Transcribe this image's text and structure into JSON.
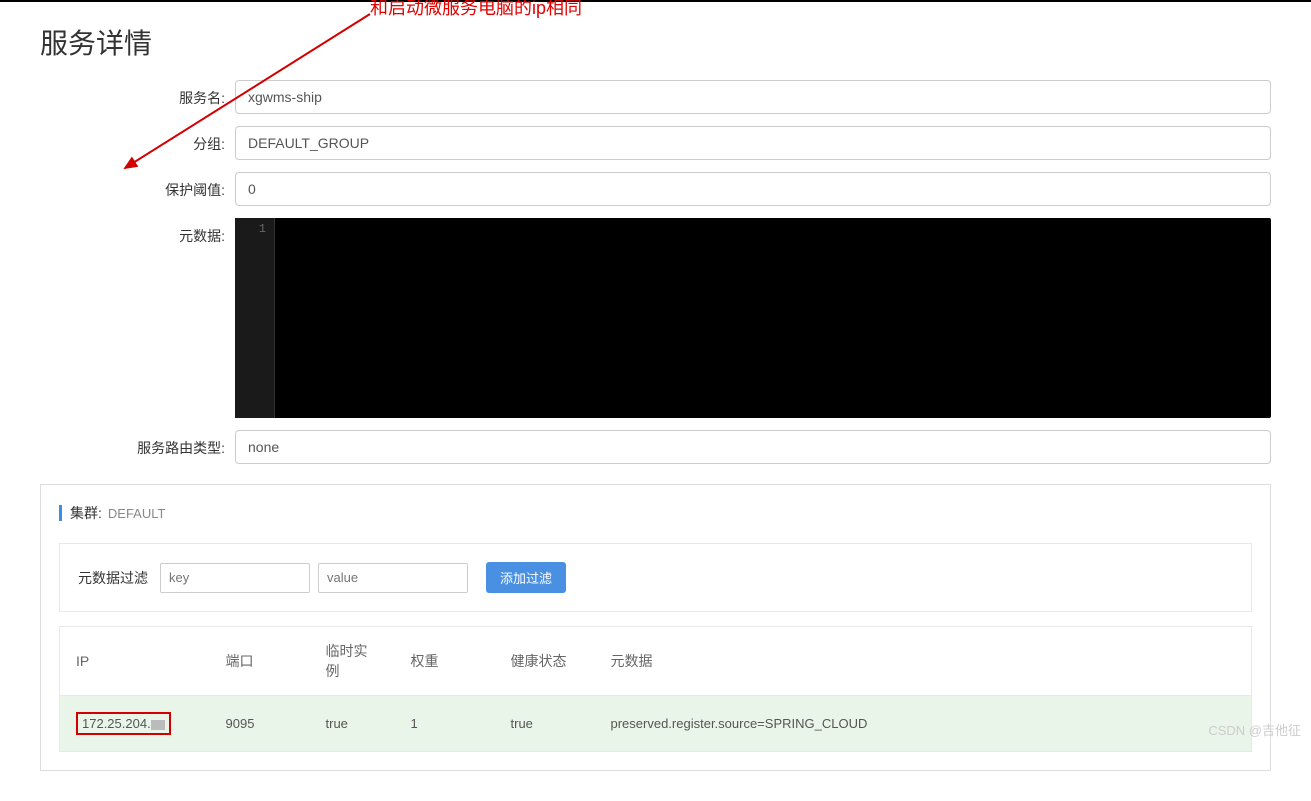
{
  "page": {
    "title": "服务详情"
  },
  "form": {
    "service_name_label": "服务名:",
    "service_name_value": "xgwms-ship",
    "group_label": "分组:",
    "group_value": "DEFAULT_GROUP",
    "threshold_label": "保护阈值:",
    "threshold_value": "0",
    "metadata_label": "元数据:",
    "metadata_line": "1",
    "route_type_label": "服务路由类型:",
    "route_type_value": "none"
  },
  "cluster": {
    "title": "集群:",
    "name": "DEFAULT"
  },
  "filter": {
    "label": "元数据过滤",
    "key_placeholder": "key",
    "value_placeholder": "value",
    "add_button": "添加过滤"
  },
  "table": {
    "headers": {
      "ip": "IP",
      "port": "端口",
      "ephemeral": "临时实例",
      "weight": "权重",
      "health": "健康状态",
      "metadata": "元数据"
    },
    "rows": [
      {
        "ip": "172.25.204.",
        "port": "9095",
        "ephemeral": "true",
        "weight": "1",
        "health": "true",
        "metadata": "preserved.register.source=SPRING_CLOUD"
      }
    ]
  },
  "annotation": {
    "text": "和启动微服务电脑的ip相同"
  },
  "watermark": "CSDN @吉他征"
}
